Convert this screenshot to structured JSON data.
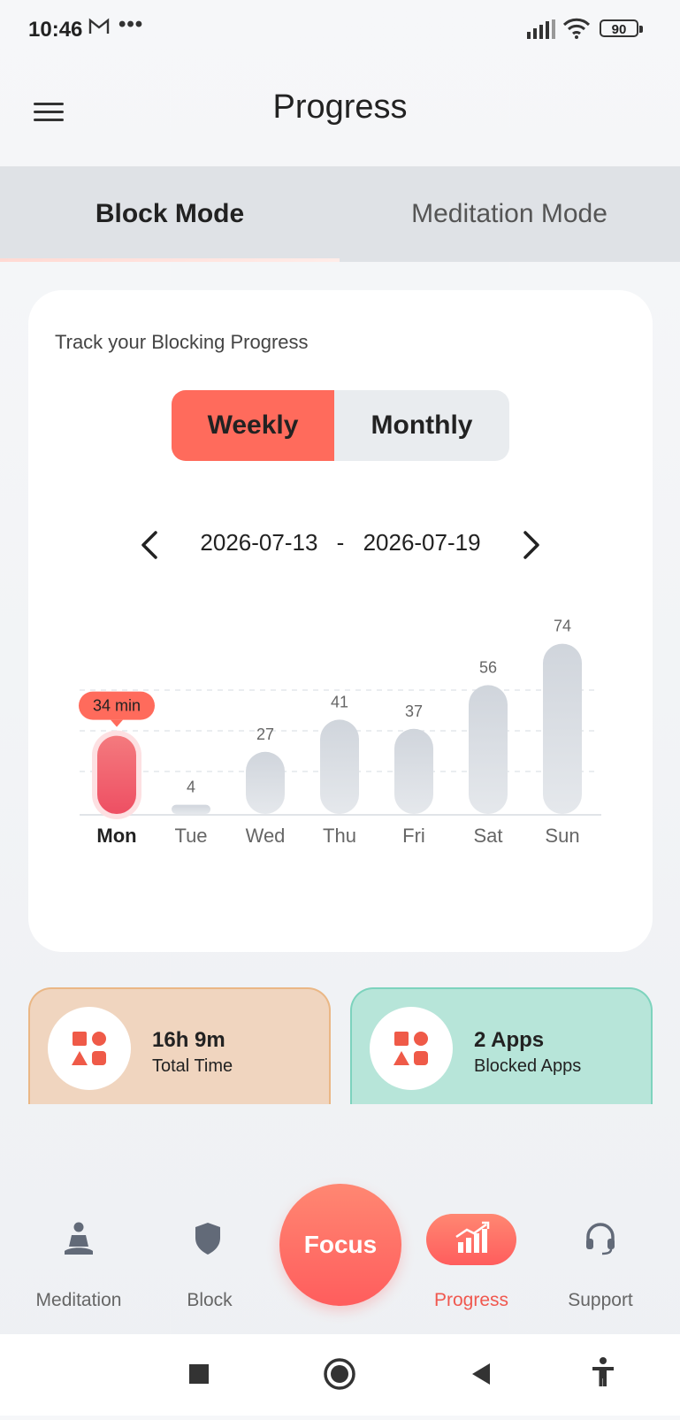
{
  "status_bar": {
    "time": "10:46",
    "battery": "90"
  },
  "header": {
    "title": "Progress"
  },
  "mode_tabs": [
    {
      "label": "Block Mode",
      "active": true
    },
    {
      "label": "Meditation Mode",
      "active": false
    }
  ],
  "card": {
    "heading": "Track your Blocking Progress",
    "period_toggle": [
      {
        "label": "Weekly",
        "active": true
      },
      {
        "label": "Monthly",
        "active": false
      }
    ],
    "date_range": {
      "start": "2026-07-13",
      "separator": "-",
      "end": "2026-07-19"
    }
  },
  "chart_data": {
    "type": "bar",
    "categories": [
      "Mon",
      "Tue",
      "Wed",
      "Thu",
      "Fri",
      "Sat",
      "Sun"
    ],
    "values": [
      34,
      4,
      27,
      41,
      37,
      56,
      74
    ],
    "data_labels": [
      "34 min",
      "4",
      "27",
      "41",
      "37",
      "56",
      "74"
    ],
    "selected_index": 0,
    "colors": {
      "selected": "#f2546a",
      "default": "#d4d8de",
      "tooltip": "#ff6b5c"
    },
    "grid": "dashed"
  },
  "stats": [
    {
      "value": "16h 9m",
      "label": "Total Time",
      "icon": "apps-shapes-icon"
    },
    {
      "value": "2 Apps",
      "label": "Blocked Apps",
      "icon": "apps-shapes-icon"
    }
  ],
  "bottom_nav": [
    {
      "label": "Meditation",
      "icon": "meditation-icon",
      "active": false
    },
    {
      "label": "Block",
      "icon": "shield-icon",
      "active": false
    },
    {
      "label": "Focus",
      "icon": "",
      "active": false
    },
    {
      "label": "Progress",
      "icon": "bar-chart-icon",
      "active": true
    },
    {
      "label": "Support",
      "icon": "headset-icon",
      "active": false
    }
  ],
  "colors": {
    "accent": "#ff6b5c",
    "active_nav_text": "#f0584f"
  }
}
